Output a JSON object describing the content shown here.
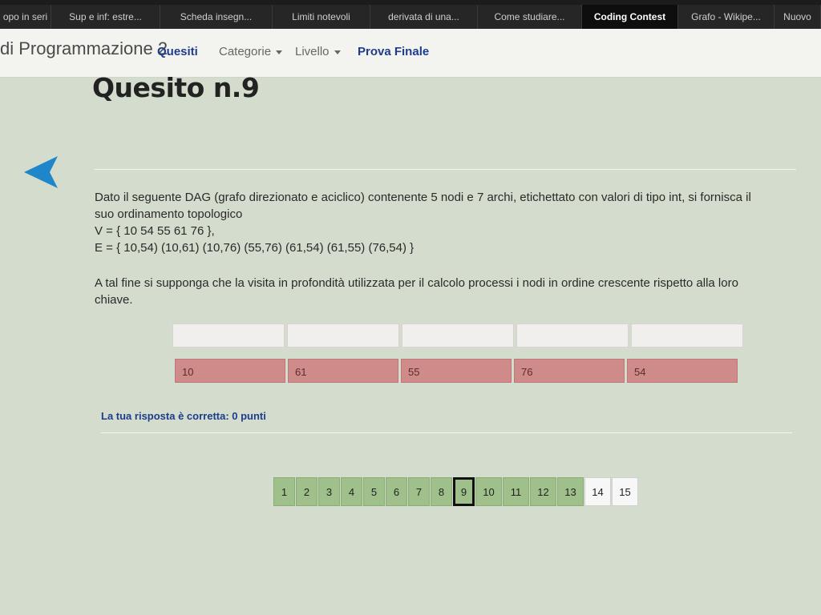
{
  "browser": {
    "tabs": [
      {
        "label": "opo in seri",
        "active": false
      },
      {
        "label": "Sup e inf: estre...",
        "active": false
      },
      {
        "label": "Scheda insegn...",
        "active": false
      },
      {
        "label": "Limiti notevoli",
        "active": false
      },
      {
        "label": "derivata di una...",
        "active": false
      },
      {
        "label": "Come studiare...",
        "active": false
      },
      {
        "label": "Coding Contest",
        "active": true
      },
      {
        "label": "Grafo - Wikipe...",
        "active": false
      },
      {
        "label": "Nuovo",
        "active": false
      }
    ]
  },
  "nav": {
    "brand": "di Programmazione 2",
    "items": [
      {
        "label": "Quesiti"
      },
      {
        "label": "Categorie"
      },
      {
        "label": "Livello"
      },
      {
        "label": "Prova Finale"
      }
    ]
  },
  "quiz": {
    "title": "Quesito n.9",
    "question_line1": "Dato il seguente DAG (grafo direzionato e aciclico) contenente 5 nodi e 7 archi, etichettato con valori di tipo int, si fornisca il suo ordinamento topologico",
    "question_line2": "V = { 10 54 55 61 76 },",
    "question_line3": "E = { 10,54) (10,61) (10,76) (55,76) (61,54) (61,55) (76,54) }",
    "question_line4": "A tal fine si supponga che la visita in profondità utilizzata per il calcolo processi i nodi in ordine crescente rispetto alla loro chiave.",
    "answers": [
      "10",
      "61",
      "55",
      "76",
      "54"
    ],
    "feedback": "La tua risposta è corretta: 0 punti"
  },
  "pagination": {
    "current": "9",
    "answered": [
      "1",
      "2",
      "3",
      "4",
      "5",
      "6",
      "7",
      "8",
      "9",
      "10",
      "11",
      "12",
      "13"
    ],
    "pages": [
      "1",
      "2",
      "3",
      "4",
      "5",
      "6",
      "7",
      "8",
      "9",
      "10",
      "11",
      "12",
      "13",
      "14",
      "15"
    ]
  },
  "colors": {
    "answer_bg": "#cf8a8a",
    "answered_page": "#9fc08a",
    "accent_blue": "#1d3d8c",
    "back_arrow": "#1f86c9"
  },
  "icons": {
    "back": "back-arrow-icon",
    "caret": "chevron-down-icon"
  }
}
